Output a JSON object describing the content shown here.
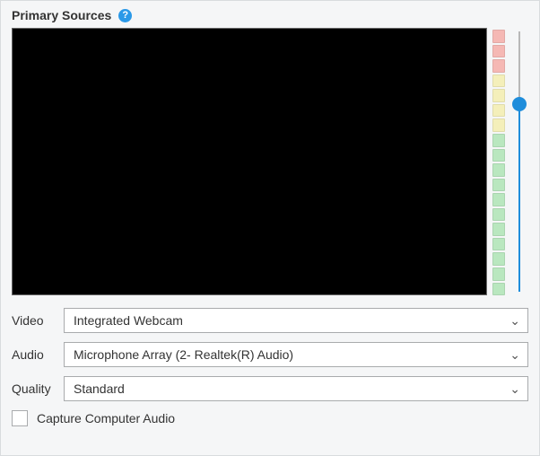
{
  "header": {
    "title": "Primary Sources",
    "help_glyph": "?"
  },
  "meter": {
    "segments": [
      "red",
      "red",
      "red",
      "yellow",
      "yellow",
      "yellow",
      "yellow",
      "green",
      "green",
      "green",
      "green",
      "green",
      "green",
      "green",
      "green",
      "green",
      "green",
      "green"
    ]
  },
  "slider": {
    "value_percent": 72
  },
  "form": {
    "video_label": "Video",
    "video_value": "Integrated Webcam",
    "audio_label": "Audio",
    "audio_value": "Microphone Array (2- Realtek(R) Audio)",
    "quality_label": "Quality",
    "quality_value": "Standard"
  },
  "capture": {
    "label": "Capture Computer Audio",
    "checked": false
  },
  "glyphs": {
    "chevron_down": "⌄"
  }
}
